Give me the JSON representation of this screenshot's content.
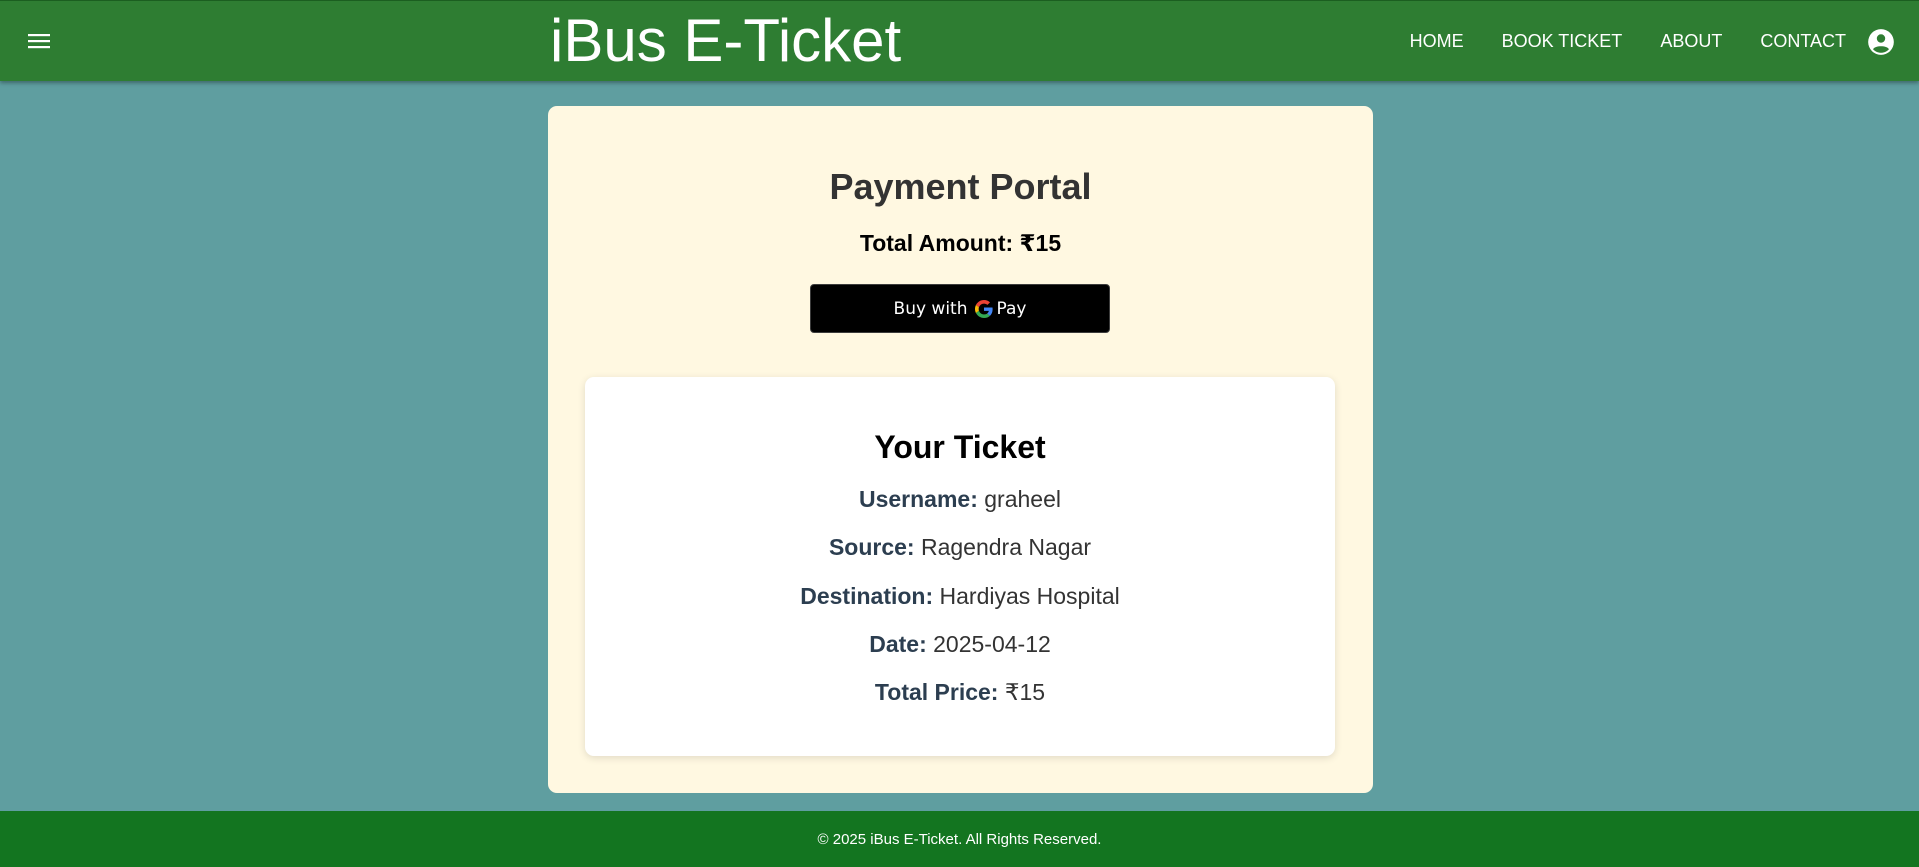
{
  "header": {
    "title": "iBus E-Ticket",
    "nav": [
      "HOME",
      "BOOK TICKET",
      "ABOUT",
      "CONTACT"
    ],
    "menu_icon": "hamburger-menu-icon",
    "account_icon": "account-circle-icon",
    "bg_color": "#2e7d32"
  },
  "payment": {
    "title": "Payment Portal",
    "total_label": "Total Amount:",
    "total_value": "₹15",
    "button_prefix": "Buy with",
    "button_brand": "Pay",
    "card_color": "#fff8e1"
  },
  "ticket": {
    "title": "Your Ticket",
    "fields": [
      {
        "label": "Username:",
        "value": "graheel"
      },
      {
        "label": "Source:",
        "value": "Ragendra Nagar"
      },
      {
        "label": "Destination:",
        "value": "Hardiyas Hospital"
      },
      {
        "label": "Date:",
        "value": "2025-04-12"
      },
      {
        "label": "Total Price:",
        "value": "₹15"
      }
    ]
  },
  "footer": {
    "text": "© 2025 iBus E-Ticket. All Rights Reserved.",
    "bg_color": "#137520"
  },
  "page": {
    "bg_color": "#5f9ea0"
  }
}
